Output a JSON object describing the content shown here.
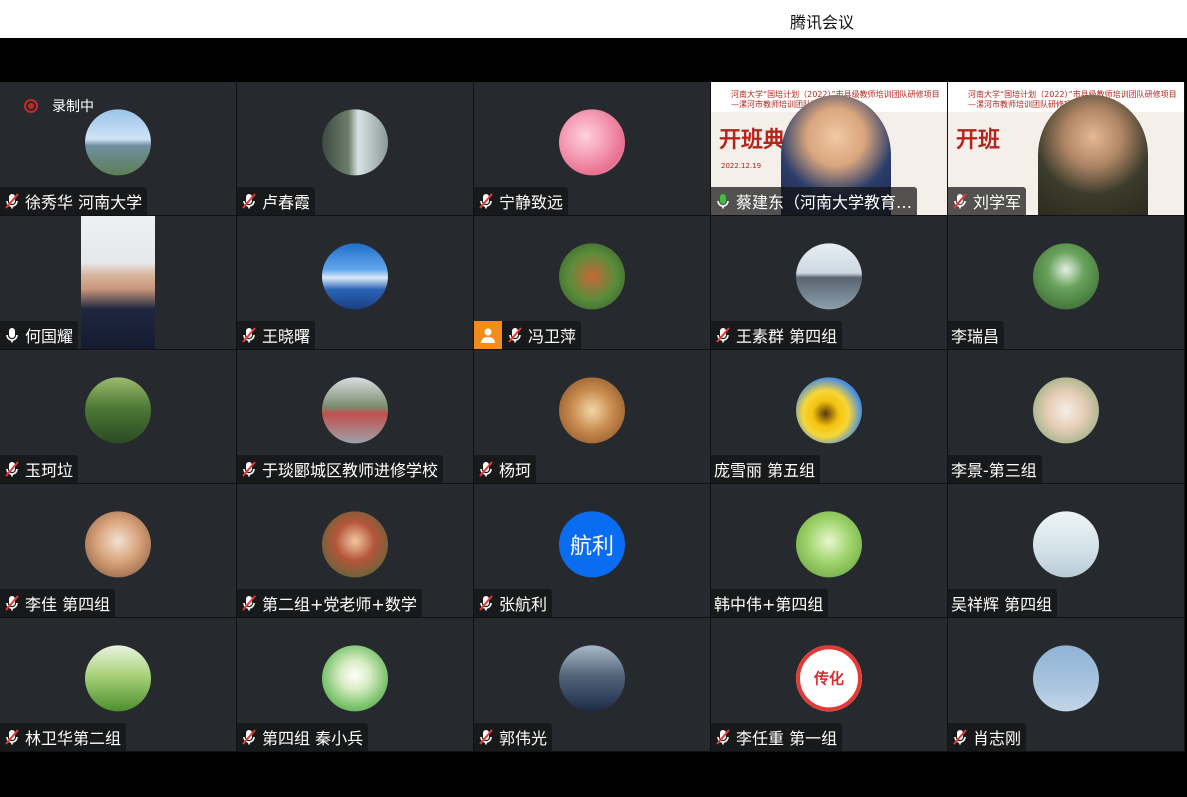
{
  "window": {
    "title": "腾讯会议"
  },
  "recording": {
    "label": "录制中"
  },
  "colors": {
    "background": "#000000",
    "tile": "#26292d",
    "muted_mic": "#ffffff",
    "active_mic": "#3fbf3f",
    "recording": "#c62828"
  },
  "participants": [
    {
      "name": "徐秀华 河南大学",
      "mic": "muted",
      "avatar": "bridge-photo"
    },
    {
      "name": "卢春霞",
      "mic": "muted",
      "avatar": "window-photo"
    },
    {
      "name": "宁静致远",
      "mic": "muted",
      "avatar": "blossom-photo"
    },
    {
      "name": "蔡建东（河南大学教育…",
      "mic": "active",
      "avatar": "video",
      "slide": {
        "header": "河南大学“国培计划（2022）”市县级教师培训团队研修项目 —漯河市教师培训团队研修项目",
        "title": "开班典礼",
        "date": "2022.12.19"
      }
    },
    {
      "name": "刘学军",
      "mic": "muted",
      "avatar": "video",
      "slide": {
        "header": "河南大学“国培计划（2022）”市县级教师培训团队研修项目 —漯河市教师培训团队研修项目",
        "title": "开班",
        "date": ""
      }
    },
    {
      "name": "何国耀",
      "mic": "on",
      "avatar": "video-portrait"
    },
    {
      "name": "王晓曙",
      "mic": "muted",
      "avatar": "lake-photo"
    },
    {
      "name": "冯卫萍",
      "mic": "muted",
      "avatar": "autumn-photo",
      "badge": "person-icon"
    },
    {
      "name": "王素群 第四组",
      "mic": "muted",
      "avatar": "pier-photo"
    },
    {
      "name": "李瑞昌",
      "mic": "none",
      "avatar": "plant-photo"
    },
    {
      "name": "玉珂垃",
      "mic": "muted",
      "avatar": "forest-road-photo"
    },
    {
      "name": "于琰郾城区教师进修学校",
      "mic": "muted",
      "avatar": "path-photo"
    },
    {
      "name": "杨珂",
      "mic": "muted",
      "avatar": "corridor-photo"
    },
    {
      "name": "庞雪丽  第五组",
      "mic": "none",
      "avatar": "sunflower-photo"
    },
    {
      "name": "李景-第三组",
      "mic": "none",
      "avatar": "flowers-photo"
    },
    {
      "name": "李佳 第四组",
      "mic": "muted",
      "avatar": "cats-photo"
    },
    {
      "name": "第二组+党老师+数学",
      "mic": "muted",
      "avatar": "child-photo"
    },
    {
      "name": "张航利",
      "mic": "muted",
      "avatar": "text",
      "avatar_text": "航利"
    },
    {
      "name": "韩中伟+第四组",
      "mic": "none",
      "avatar": "frog-photo"
    },
    {
      "name": "吴祥辉 第四组",
      "mic": "none",
      "avatar": "branch-photo"
    },
    {
      "name": "林卫华第二组",
      "mic": "muted",
      "avatar": "tree-photo"
    },
    {
      "name": "第四组    秦小兵",
      "mic": "muted",
      "avatar": "dandelion-photo"
    },
    {
      "name": "郭伟光",
      "mic": "muted",
      "avatar": "man-photo"
    },
    {
      "name": "李任重  第一组",
      "mic": "muted",
      "avatar": "logo-photo",
      "avatar_text": "传化"
    },
    {
      "name": "肖志刚",
      "mic": "muted",
      "avatar": "birds-photo"
    }
  ]
}
